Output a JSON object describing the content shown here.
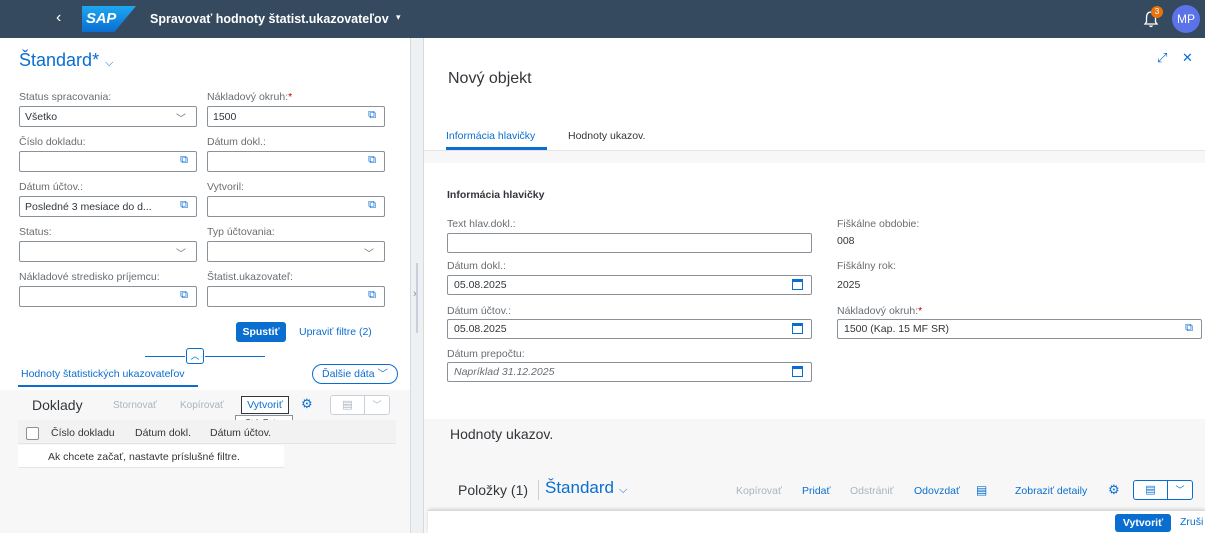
{
  "shell": {
    "back_icon": "‹",
    "logo": "SAP",
    "title": "Spravovať hodnoty štatist.ukazovateľov",
    "title_caret": "▾",
    "notification_count": "3",
    "avatar_initials": "MP"
  },
  "left": {
    "variant": "Štandard",
    "variant_mark": "*",
    "filters": {
      "status_spracovania_label": "Status spracovania:",
      "status_spracovania_value": "Všetko",
      "nakladovy_okruh_label": "Nákladový okruh:",
      "nakladovy_okruh_value": "1500",
      "cislo_dokladu_label": "Číslo dokladu:",
      "datum_dokl_label": "Dátum dokl.:",
      "datum_uctov_label": "Dátum účtov.:",
      "datum_uctov_value": "Posledné 3 mesiace do d...",
      "vytvoril_label": "Vytvoril:",
      "status_label": "Status:",
      "typ_uctovania_label": "Typ účtovania:",
      "nakl_stredisko_label": "Nákladové stredisko príjemcu:",
      "statist_ukazovatel_label": "Štatist.ukazovateľ:"
    },
    "run_button": "Spustiť",
    "adapt_filters": "Upraviť filtre (2)",
    "tab": "Hodnoty štatistických ukazovateľov",
    "more_data": "Ďalšie dáta",
    "toolbar": {
      "title": "Doklady",
      "stornovat": "Stornovať",
      "kopirovat": "Kopírovať",
      "vytvorit": "Vytvoriť",
      "tooltip": "Ctrl+Enter"
    },
    "table": {
      "columns": [
        "Číslo dokladu",
        "Dátum dokl.",
        "Dátum účtov."
      ],
      "empty_message": "Ak chcete začať, nastavte príslušné filtre."
    }
  },
  "right": {
    "title": "Nový objekt",
    "tabs": [
      "Informácia hlavičky",
      "Hodnoty ukazov."
    ],
    "section_title": "Informácia hlavičky",
    "text_hlav_label": "Text hlav.dokl.:",
    "fiskalne_obdobie_label": "Fiškálne obdobie:",
    "fiskalne_obdobie_value": "008",
    "datum_dokl_label": "Dátum dokl.:",
    "datum_dokl_value": "05.08.2025",
    "fiskalny_rok_label": "Fiškálny rok:",
    "fiskalny_rok_value": "2025",
    "datum_uctov_label": "Dátum účtov.:",
    "datum_uctov_value": "05.08.2025",
    "nakladovy_okruh_label": "Nákladový okruh:",
    "nakladovy_okruh_value": "1500 (Kap. 15 MF SR)",
    "datum_prepoctu_label": "Dátum prepočtu:",
    "datum_prepoctu_placeholder": "Napríklad 31.12.2025",
    "hodnoty_title": "Hodnoty ukazov.",
    "items": {
      "title": "Položky (1)",
      "variant": "Štandard",
      "kopirovat": "Kopírovať",
      "pridat": "Pridať",
      "odstranit": "Odstrániť",
      "odovzdat": "Odovzdať",
      "zobrazit_detaily": "Zobraziť detaily"
    },
    "footer": {
      "create": "Vytvoriť",
      "cancel": "Zruši"
    }
  },
  "colors": {
    "shell": "#354a5f",
    "accent": "#0a6ed1",
    "required": "#bb0000",
    "badge": "#e9730c"
  }
}
